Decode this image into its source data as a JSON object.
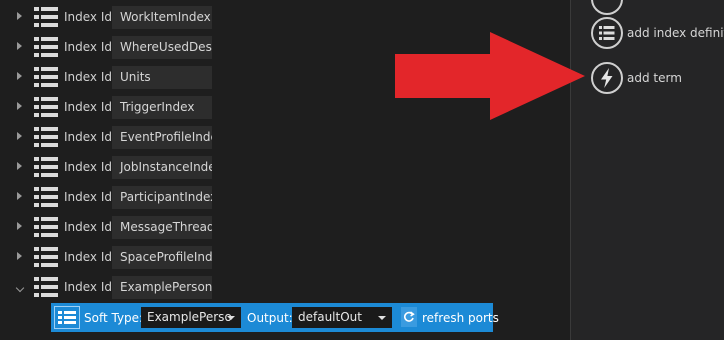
{
  "index_rows": [
    {
      "label": "Index Id:",
      "value": "WorkItemIndex"
    },
    {
      "label": "Index Id:",
      "value": "WhereUsedDesig"
    },
    {
      "label": "Index Id:",
      "value": "Units"
    },
    {
      "label": "Index Id:",
      "value": "TriggerIndex"
    },
    {
      "label": "Index Id:",
      "value": "EventProfileIndex"
    },
    {
      "label": "Index Id:",
      "value": "JobInstanceIndex"
    },
    {
      "label": "Index Id:",
      "value": "ParticipantIndex"
    },
    {
      "label": "Index Id:",
      "value": "MessageThreadIn"
    },
    {
      "label": "Index Id:",
      "value": "SpaceProfileIndex"
    },
    {
      "label": "Index Id:",
      "value": "ExamplePersonIn"
    }
  ],
  "toolbar": {
    "soft_type_label": "Soft Type:",
    "soft_type_value": "ExamplePerso",
    "output_label": "Output:",
    "output_value": "defaultOut",
    "refresh_label": "refresh ports"
  },
  "actions": {
    "add_index_definition": "add index definition",
    "add_term": "add term"
  },
  "colors": {
    "toolbar_accent": "#1c8ad6",
    "arrow": "#e3262a"
  }
}
